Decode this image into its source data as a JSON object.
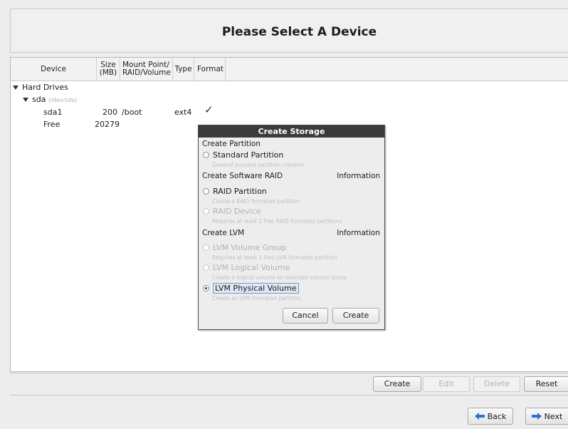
{
  "header": {
    "title": "Please Select A Device"
  },
  "columns": [
    {
      "label1": "Device",
      "label2": ""
    },
    {
      "label1": "Size",
      "label2": "(MB)"
    },
    {
      "label1": "Mount Point/",
      "label2": "RAID/Volume"
    },
    {
      "label1": "Type",
      "label2": ""
    },
    {
      "label1": "Format",
      "label2": ""
    }
  ],
  "tree": {
    "hard_drives": "Hard Drives",
    "disk_name": "sda",
    "disk_path": "(/dev/sda)",
    "rows": [
      {
        "device": "sda1",
        "size": "200",
        "mount": "/boot",
        "type": "ext4",
        "format": "✓"
      },
      {
        "device": "Free",
        "size": "20279",
        "mount": "",
        "type": "",
        "format": ""
      }
    ]
  },
  "dialog": {
    "title": "Create Storage",
    "partition_section": "Create Partition",
    "standard_partition": "Standard Partition",
    "standard_hint": "General purpose partition creation",
    "raid_section": "Create Software RAID",
    "information": "Information",
    "raid_partition": "RAID Partition",
    "raid_partition_hint": "Create a RAID formated partition",
    "raid_device": "RAID Device",
    "raid_device_hint": "Requires at least 2 free RAID formated partitions",
    "lvm_section": "Create LVM",
    "lvm_vg": "LVM Volume Group",
    "lvm_vg_hint": "Requires at least 1 free LVM formated partition",
    "lvm_lv": "LVM Logical Volume",
    "lvm_lv_hint": "Create a logical volume on selected volume group",
    "lvm_pv": "LVM Physical Volume",
    "lvm_pv_hint": "Create an LVM formated partition",
    "cancel": "Cancel",
    "create": "Create"
  },
  "toolbar": {
    "create": "Create",
    "edit": "Edit",
    "delete": "Delete",
    "reset": "Reset"
  },
  "nav": {
    "back": "Back",
    "next": "Next"
  },
  "colors": {
    "dialog_title_bg": "#3b3b3b",
    "arrow_blue": "#2f6fd0"
  }
}
